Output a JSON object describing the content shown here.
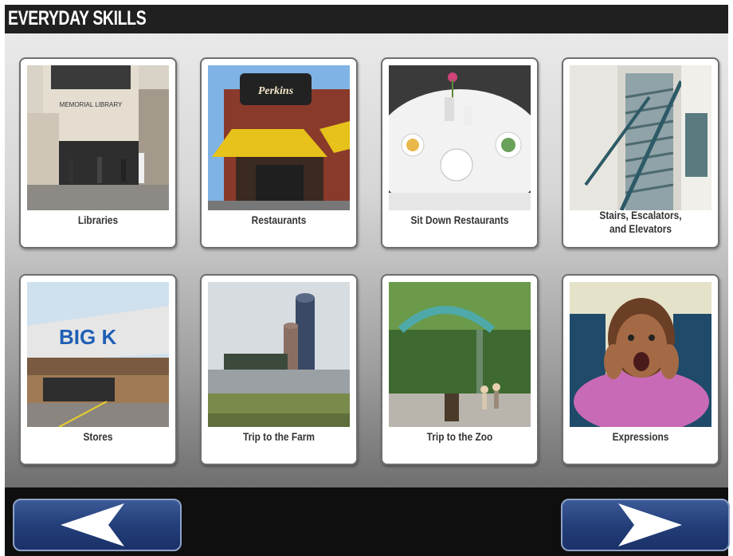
{
  "header": {
    "title": "EVERYDAY SKILLS"
  },
  "cards": [
    {
      "label": "Libraries",
      "image_text": "MEMORIAL LIBRARY"
    },
    {
      "label": "Restaurants",
      "image_text": "Perkins"
    },
    {
      "label": "Sit Down Restaurants"
    },
    {
      "label": "Stairs, Escalators,\nand Elevators"
    },
    {
      "label": "Stores",
      "image_text": "BIG K"
    },
    {
      "label": "Trip to the Farm"
    },
    {
      "label": "Trip to the Zoo"
    },
    {
      "label": "Expressions"
    }
  ],
  "nav": {
    "back_icon": "left-arrow-icon",
    "forward_icon": "right-arrow-icon"
  },
  "colors": {
    "nav_button": "#243f7a",
    "title_bar": "#202020"
  }
}
